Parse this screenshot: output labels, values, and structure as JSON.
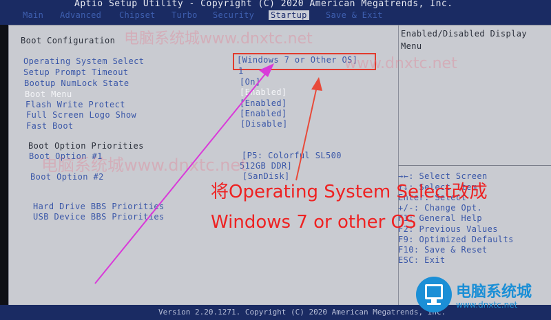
{
  "title": "Aptio Setup Utility - Copyright (C) 2020 American Megatrends, Inc.",
  "tabs": [
    "Main",
    "Advanced",
    "Chipset",
    "Turbo",
    "Security",
    "Startup",
    "Save & Exit"
  ],
  "active_tab": "Startup",
  "section_title": "Boot Configuration",
  "settings": [
    {
      "label": "Operating System Select",
      "value": "[Windows 7 or Other OS]"
    },
    {
      "label": "Setup Prompt Timeout",
      "value": "1"
    },
    {
      "label": "Bootup NumLock State",
      "value": "[On]"
    },
    {
      "label": "Boot Menu",
      "value": "[Enabled]"
    },
    {
      "label": "Flash Write Protect",
      "value": "[Enabled]"
    },
    {
      "label": "Full Screen Logo Show",
      "value": "[Enabled]"
    },
    {
      "label": "Fast Boot",
      "value": "[Disable]"
    }
  ],
  "boot_priorities": {
    "heading": "Boot Option Priorities",
    "option1_label": "Boot Option #1",
    "option1_value_line1": "[P5: Colorful SL500",
    "option1_value_line2": "512GB DDR]",
    "option2_label": "Boot Option #2",
    "option2_value": "[SanDisk]"
  },
  "bbs": [
    "Hard Drive BBS Priorities",
    "USB Device BBS Priorities"
  ],
  "help_text": [
    "Enabled/Disabled Display",
    "Menu"
  ],
  "key_help": [
    "→←: Select Screen",
    "↑↓: Select Item",
    "Enter: Select",
    "+/-: Change Opt.",
    "F1: General Help",
    "F2: Previous Values",
    "F9: Optimized Defaults",
    "F10: Save & Reset",
    "ESC: Exit"
  ],
  "version": "Version 2.20.1271. Copyright (C) 2020 American Megatrends, Inc.",
  "annotation": {
    "line1": "将Operating System Select改成",
    "line2": "Windows 7 or other OS"
  },
  "watermark": {
    "text1": "电脑系统城www.dnxtc.net",
    "text2": "www.dnxtc.net"
  },
  "logo": {
    "name": "电脑系统城",
    "url": "www.dnxtc.net"
  },
  "colors": {
    "highlight": "#e23b2d",
    "annotation": "#ee2222",
    "arrow_magenta": "#d93ad9",
    "arrow_red": "#e84a3a",
    "panel": "#c9cbd1",
    "title_bar": "#1a2b63"
  }
}
